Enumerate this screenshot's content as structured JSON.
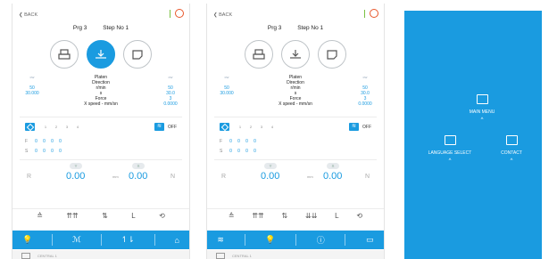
{
  "screen1": {
    "back_label": "BACK",
    "prog_label": "Prg 3",
    "step_label": "Step No 1",
    "modes": [
      "printer-icon",
      "platen-arrow-icon",
      "tray-icon"
    ],
    "params": {
      "left_header": "cw",
      "left_v1": "50",
      "left_v2": "30.000",
      "center": [
        "Platen",
        "Direction",
        "r/min",
        "s",
        "Force",
        "X speed - mm/sn"
      ],
      "right_header": "cw",
      "right_v1": "50",
      "right_v2": "30.0",
      "right_v3": "3",
      "right_v4": "0.0000"
    },
    "speed_nums": [
      "1",
      "2",
      "3",
      "4"
    ],
    "off_label": "OFF",
    "f_row": {
      "key": "F",
      "values": [
        "0",
        "0",
        "0",
        "0"
      ]
    },
    "s_row": {
      "key": "S",
      "values": [
        "0",
        "0",
        "0",
        "0"
      ]
    },
    "y_label": "Y",
    "x_label": "X",
    "r_label": "R",
    "n_label": "N",
    "r_value": "0.00",
    "mm_unit": "mm",
    "x_value": "0.00",
    "tools": [
      "≙",
      "⇈⇈",
      "⇅",
      "L",
      "⟲"
    ],
    "tabs": [
      "💡",
      "ℳ",
      "↿⇂",
      "⌂"
    ],
    "footer_text": "CENTRAL 1"
  },
  "screen2": {
    "back_label": "BACK",
    "prog_label": "Prg 3",
    "step_label": "Step No 1",
    "params": {
      "left_header": "cw",
      "left_v1": "50",
      "left_v2": "30.000",
      "center": [
        "Platen",
        "Direction",
        "r/min",
        "s",
        "Force",
        "X speed - mm/sn"
      ],
      "right_header": "cw",
      "right_v1": "50",
      "right_v2": "30.0",
      "right_v3": "3",
      "right_v4": "0.0000"
    },
    "speed_nums": [
      "1",
      "2",
      "3",
      "4"
    ],
    "off_label": "OFF",
    "f_row": {
      "key": "F",
      "values": [
        "0",
        "0",
        "0",
        "0"
      ]
    },
    "s_row": {
      "key": "S",
      "values": [
        "0",
        "0",
        "0",
        "0"
      ]
    },
    "y_label": "Y",
    "x_label": "X",
    "r_label": "R",
    "n_label": "N",
    "r_value": "0.00",
    "mm_unit": "mm",
    "x_value": "0.00",
    "tools": [
      "≙",
      "⇈⇈",
      "⇅",
      "⇊⇊",
      "L",
      "⟲"
    ],
    "tabs": [
      "≋",
      "💡",
      "ⓘ",
      "▭"
    ],
    "footer_text": "CENTRAL 1"
  },
  "menu": {
    "main_menu": "MAIN MENU",
    "language_select": "LANGUAGE  SELECT",
    "contact": "CONTACT",
    "chevron": "^"
  },
  "colors": {
    "accent": "#1a9be0",
    "power": "#e8562a",
    "status": "#7ac142"
  }
}
